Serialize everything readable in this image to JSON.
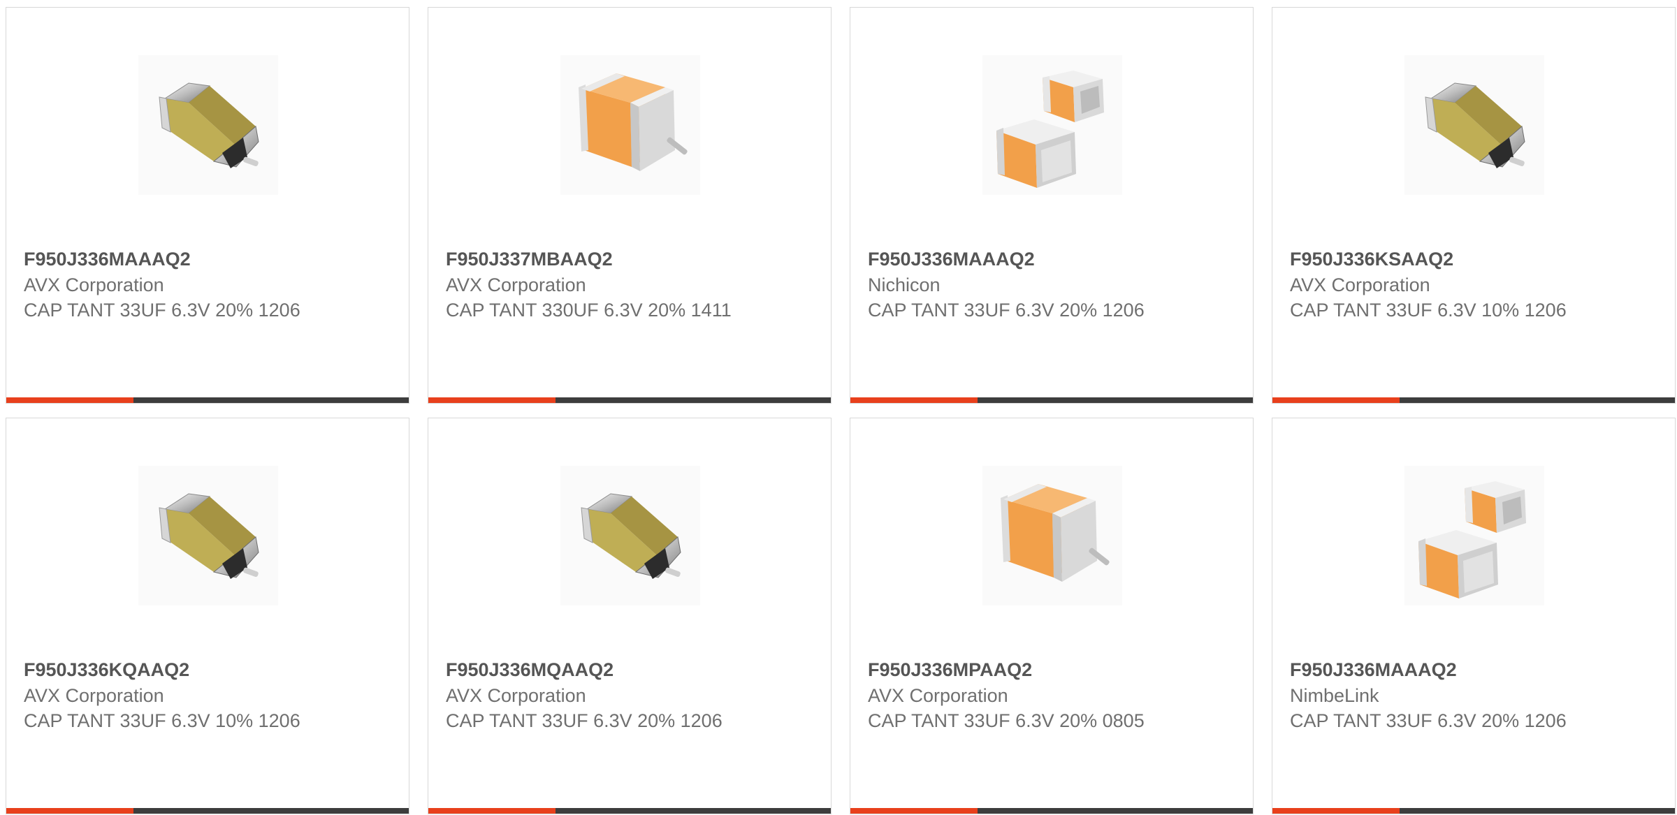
{
  "colors": {
    "accent": "#e8401c",
    "bar": "#3d3d3d",
    "card_border": "#d8d8d8",
    "text_bold": "#555555",
    "text": "#6f6f6f"
  },
  "products": [
    {
      "part_number": "F950J336MAAAQ2",
      "manufacturer": "AVX Corporation",
      "description": "CAP TANT 33UF 6.3V 20% 1206",
      "image_icon": "tantalum-capacitor-yellow-icon"
    },
    {
      "part_number": "F950J337MBAAQ2",
      "manufacturer": "AVX Corporation",
      "description": "CAP TANT 330UF 6.3V 20% 1411",
      "image_icon": "tantalum-capacitor-orange-icon"
    },
    {
      "part_number": "F950J336MAAAQ2",
      "manufacturer": "Nichicon",
      "description": "CAP TANT 33UF 6.3V 20% 1206",
      "image_icon": "tantalum-capacitor-pair-icon"
    },
    {
      "part_number": "F950J336KSAAQ2",
      "manufacturer": "AVX Corporation",
      "description": "CAP TANT 33UF 6.3V 10% 1206",
      "image_icon": "tantalum-capacitor-yellow-icon"
    },
    {
      "part_number": "F950J336KQAAQ2",
      "manufacturer": "AVX Corporation",
      "description": "CAP TANT 33UF 6.3V 10% 1206",
      "image_icon": "tantalum-capacitor-yellow-icon"
    },
    {
      "part_number": "F950J336MQAAQ2",
      "manufacturer": "AVX Corporation",
      "description": "CAP TANT 33UF 6.3V 20% 1206",
      "image_icon": "tantalum-capacitor-yellow-icon"
    },
    {
      "part_number": "F950J336MPAAQ2",
      "manufacturer": "AVX Corporation",
      "description": "CAP TANT 33UF 6.3V 20% 0805",
      "image_icon": "tantalum-capacitor-orange-icon"
    },
    {
      "part_number": "F950J336MAAAQ2",
      "manufacturer": "NimbeLink",
      "description": "CAP TANT 33UF 6.3V 20% 1206",
      "image_icon": "tantalum-capacitor-pair-icon"
    }
  ]
}
